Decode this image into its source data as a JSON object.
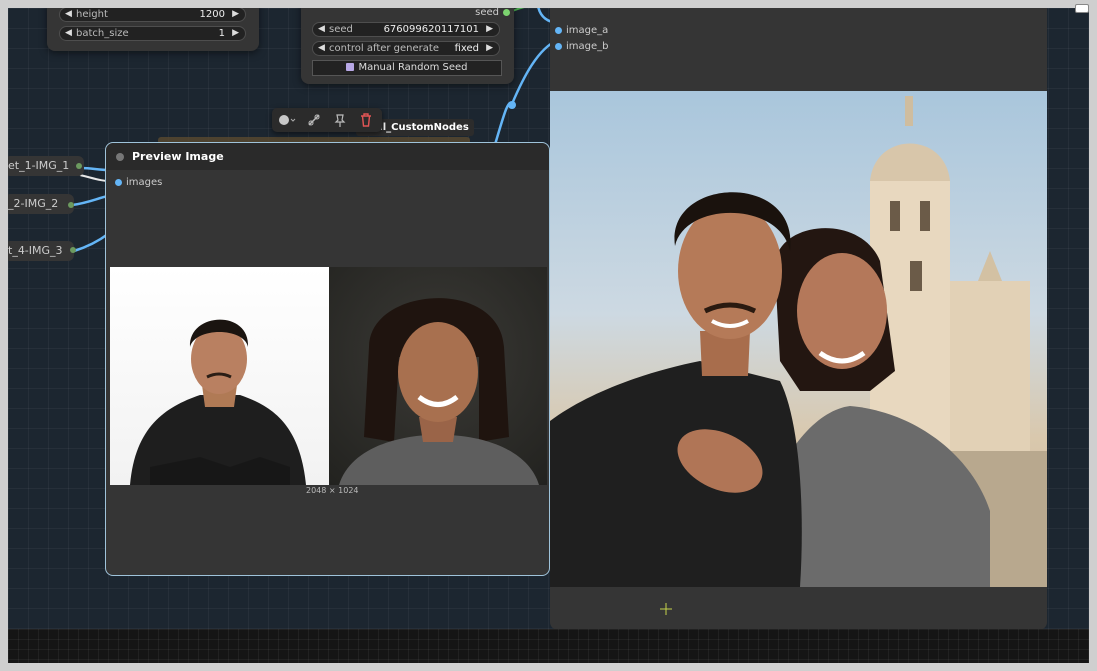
{
  "canvas_nodes": {
    "latent_node": {
      "widgets": [
        {
          "label": "height",
          "value": "1200"
        },
        {
          "label": "batch_size",
          "value": "1"
        }
      ]
    },
    "sampler_node": {
      "output_label": "seed",
      "widgets": [
        {
          "label": "seed",
          "value": "676099620117101"
        },
        {
          "label": "control after generate",
          "value": "fixed"
        }
      ],
      "button_label": "Manual Random Seed"
    },
    "reroutes": [
      {
        "label": "et_1-IMG_1"
      },
      {
        "label": "_2-IMG_2"
      },
      {
        "label": "t_4-IMG_3"
      }
    ],
    "group_label": "yroll_CustomNodes",
    "preview_node": {
      "title": "Preview Image",
      "input_label": "images",
      "dimensions": "2048 × 1024"
    },
    "compare_node": {
      "inputs": [
        {
          "label": "image_a"
        },
        {
          "label": "image_b"
        }
      ]
    }
  },
  "toolbar": {
    "icons": [
      "color-circle-icon",
      "bypass-icon",
      "pin-icon",
      "delete-icon"
    ]
  },
  "colors": {
    "canvas_bg": "#1c2630",
    "node_bg": "#353535",
    "link_blue": "#64b5f6",
    "selected_border": "#9fc3da",
    "delete_red": "#e25555"
  }
}
